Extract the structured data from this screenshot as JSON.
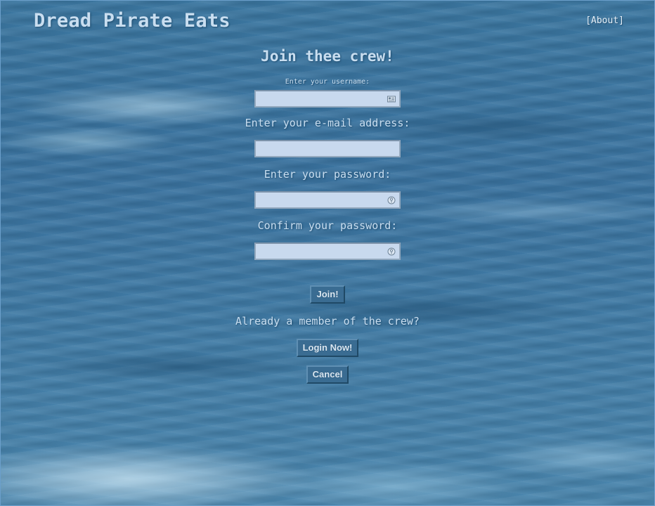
{
  "header": {
    "site_title": "Dread Pirate Eats",
    "about_label": "About",
    "about_open_bracket": "[",
    "about_close_bracket": "]"
  },
  "form": {
    "heading": "Join thee crew!",
    "username_label": "Enter your username:",
    "username_value": "",
    "email_label": "Enter your e-mail address:",
    "email_value": "",
    "password_label": "Enter your password:",
    "password_value": "",
    "confirm_label": "Confirm your password:",
    "confirm_value": "",
    "join_button": "Join!",
    "already_member_text": "Already a member of the crew?",
    "login_button": "Login Now!",
    "cancel_button": "Cancel"
  },
  "icons": {
    "username_field_icon": "id-card-icon",
    "password_field_icon": "key-icon",
    "confirm_field_icon": "key-icon"
  },
  "colors": {
    "background_water": "#3f7aa3",
    "text_light": "#c9def0",
    "input_fill": "#c8d9ee",
    "button_fill": "#3a6c92"
  }
}
